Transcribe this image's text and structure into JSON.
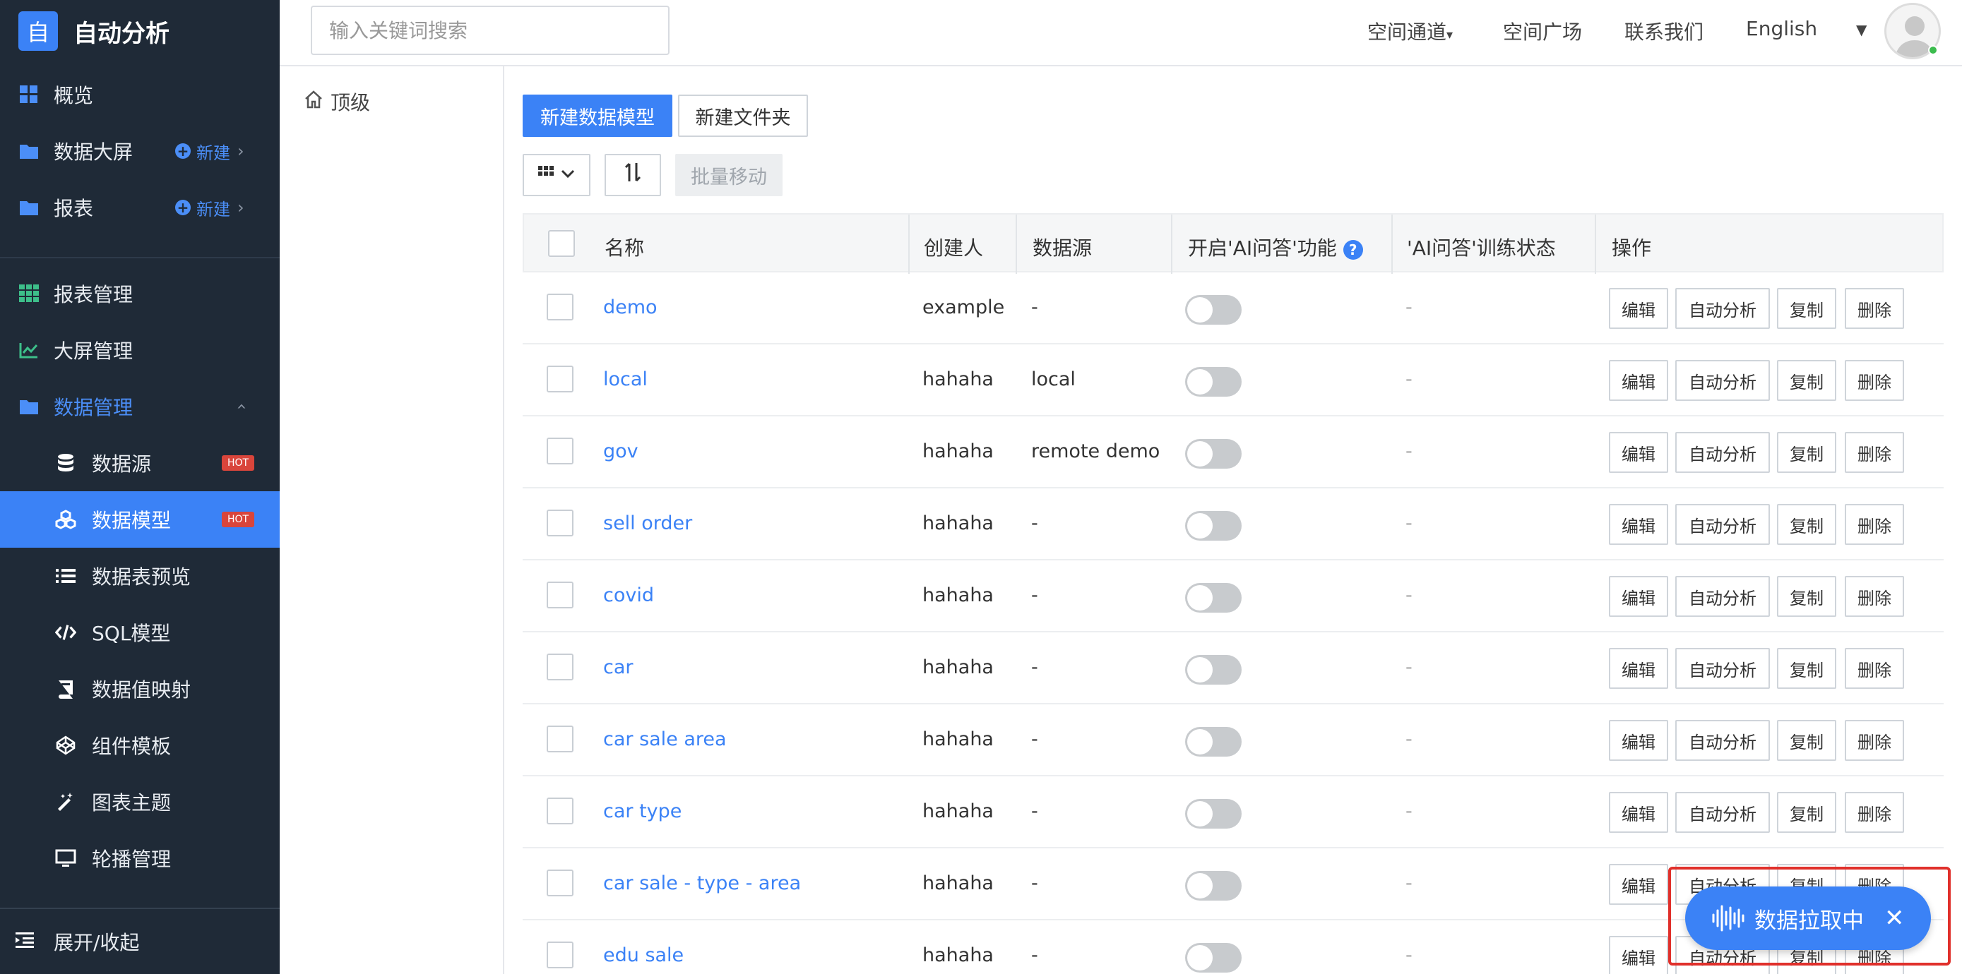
{
  "brand": {
    "logo_char": "自",
    "title": "自动分析"
  },
  "sidebar": {
    "items": [
      {
        "label": "概览",
        "icon": "dashboard-grid-icon"
      },
      {
        "label": "数据大屏",
        "icon": "folder-icon",
        "new_label": "新建"
      },
      {
        "label": "报表",
        "icon": "folder-icon",
        "new_label": "新建"
      },
      {
        "label": "报表管理",
        "icon": "table-grid-icon"
      },
      {
        "label": "大屏管理",
        "icon": "line-chart-icon"
      },
      {
        "label": "数据管理",
        "icon": "folder-icon",
        "expanded": true
      },
      {
        "label": "数据源",
        "icon": "database-icon",
        "badge": "HOT"
      },
      {
        "label": "数据模型",
        "icon": "model-cubes-icon",
        "badge": "HOT",
        "active": true
      },
      {
        "label": "数据表预览",
        "icon": "list-icon"
      },
      {
        "label": "SQL模型",
        "icon": "code-icon"
      },
      {
        "label": "数据值映射",
        "icon": "book-icon"
      },
      {
        "label": "组件模板",
        "icon": "codepen-icon"
      },
      {
        "label": "图表主题",
        "icon": "magic-wand-icon"
      },
      {
        "label": "轮播管理",
        "icon": "monitor-icon"
      }
    ],
    "toggle_label": "展开/收起"
  },
  "topbar": {
    "search_placeholder": "输入关键词搜索",
    "space_channel": "空间通道",
    "space_square": "空间广场",
    "contact": "联系我们",
    "language": "English"
  },
  "tree": {
    "root_label": "顶级"
  },
  "toolbar": {
    "new_model": "新建数据模型",
    "new_folder": "新建文件夹",
    "batch_move": "批量移动"
  },
  "table": {
    "headers": {
      "name": "名称",
      "creator": "创建人",
      "datasource": "数据源",
      "ai_enable": "开启'AI问答'功能",
      "ai_status": "'AI问答'训练状态",
      "actions": "操作"
    },
    "action_labels": {
      "edit": "编辑",
      "auto": "自动分析",
      "copy": "复制",
      "delete": "删除"
    },
    "rows": [
      {
        "name": "demo",
        "creator": "example",
        "datasource": "-",
        "ai_status": "-",
        "ai_enabled": false
      },
      {
        "name": "local",
        "creator": "hahaha",
        "datasource": "local",
        "ai_status": "-",
        "ai_enabled": false
      },
      {
        "name": "gov",
        "creator": "hahaha",
        "datasource": "remote demo",
        "ai_status": "-",
        "ai_enabled": false
      },
      {
        "name": "sell order",
        "creator": "hahaha",
        "datasource": "-",
        "ai_status": "-",
        "ai_enabled": false
      },
      {
        "name": "covid",
        "creator": "hahaha",
        "datasource": "-",
        "ai_status": "-",
        "ai_enabled": false
      },
      {
        "name": "car",
        "creator": "hahaha",
        "datasource": "-",
        "ai_status": "-",
        "ai_enabled": false
      },
      {
        "name": "car sale area",
        "creator": "hahaha",
        "datasource": "-",
        "ai_status": "-",
        "ai_enabled": false
      },
      {
        "name": "car type",
        "creator": "hahaha",
        "datasource": "-",
        "ai_status": "-",
        "ai_enabled": false
      },
      {
        "name": "car sale - type - area",
        "creator": "hahaha",
        "datasource": "-",
        "ai_status": "-",
        "ai_enabled": false
      },
      {
        "name": "edu sale",
        "creator": "hahaha",
        "datasource": "-",
        "ai_status": "-",
        "ai_enabled": false
      }
    ]
  },
  "floating": {
    "label": "数据拉取中",
    "close": "✕"
  },
  "colors": {
    "primary": "#3b82f6",
    "sidebar_bg": "#1f2a37",
    "hot_badge": "#d9453b",
    "highlight": "#e0302b"
  }
}
